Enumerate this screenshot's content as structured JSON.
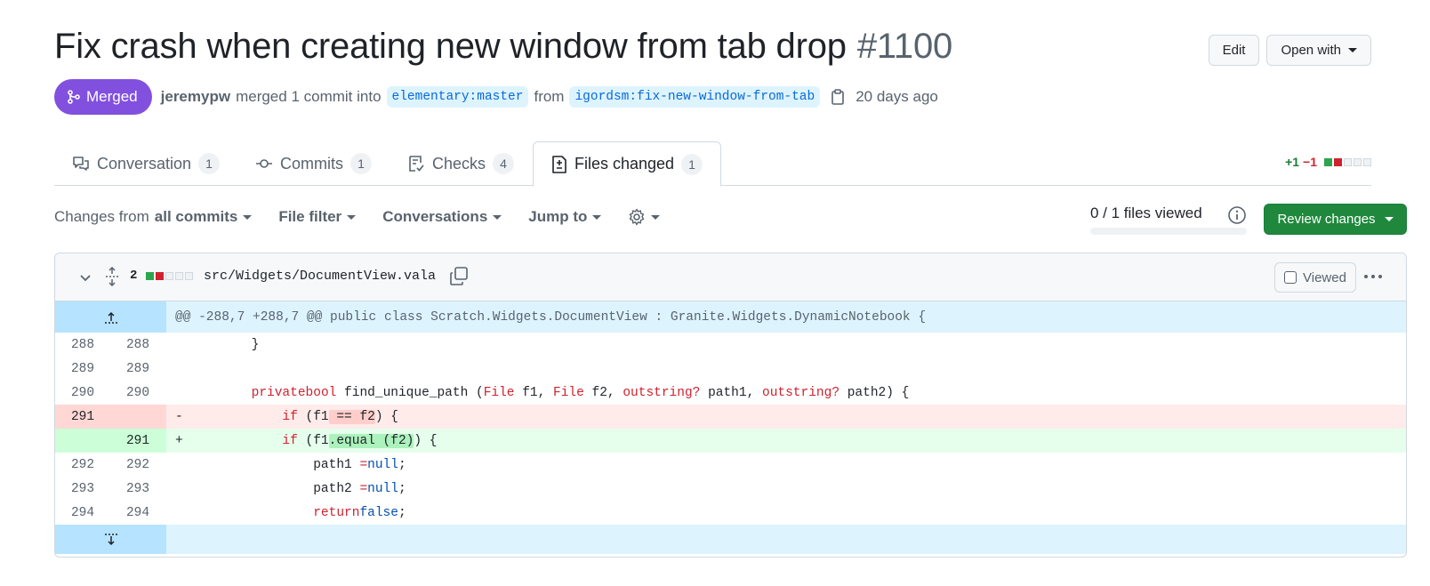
{
  "header": {
    "title": "Fix crash when creating new window from tab drop",
    "number": "#1100",
    "edit_label": "Edit",
    "open_with_label": "Open with"
  },
  "meta": {
    "status": "Merged",
    "author": "jeremypw",
    "merged_text": "merged 1 commit into",
    "base_branch": "elementary:master",
    "from_text": "from",
    "head_branch": "igordsm:fix-new-window-from-tab",
    "time": "20 days ago"
  },
  "tabs": [
    {
      "label": "Conversation",
      "count": "1",
      "icon": "comment-discussion-icon"
    },
    {
      "label": "Commits",
      "count": "1",
      "icon": "git-commit-icon"
    },
    {
      "label": "Checks",
      "count": "4",
      "icon": "checklist-icon"
    },
    {
      "label": "Files changed",
      "count": "1",
      "icon": "file-diff-icon"
    }
  ],
  "diffstat": {
    "additions": "+1",
    "deletions": "−1"
  },
  "toolbar": {
    "changes_from_prefix": "Changes from",
    "changes_from_value": "all commits",
    "file_filter": "File filter",
    "conversations": "Conversations",
    "jump_to": "Jump to"
  },
  "files_viewed": {
    "text": "0 / 1 files viewed",
    "progress": 0
  },
  "review_button": "Review changes",
  "file": {
    "changes": "2",
    "path": "src/Widgets/DocumentView.vala",
    "viewed_label": "Viewed"
  },
  "hunk_header": "@@ -288,7 +288,7 @@ public class Scratch.Widgets.DocumentView : Granite.Widgets.DynamicNotebook {",
  "lines": [
    {
      "old": "288",
      "new": "288"
    },
    {
      "old": "289",
      "new": "289"
    },
    {
      "old": "290",
      "new": "290"
    },
    {
      "old": "291",
      "new": "",
      "marker": "-"
    },
    {
      "old": "",
      "new": "291",
      "marker": "+"
    },
    {
      "old": "292",
      "new": "292"
    },
    {
      "old": "293",
      "new": "293"
    },
    {
      "old": "294",
      "new": "294"
    }
  ],
  "code": {
    "l288": "        }",
    "l290_pre": "        ",
    "l290_kw1": "private",
    "l290_ty1": "bool",
    "l290_mid1": " find_unique_path (",
    "l290_t2": "File",
    "l290_mid2": " f1, ",
    "l290_t3": "File",
    "l290_mid3": " f2, ",
    "l290_k4": "out",
    "l290_t4": "string?",
    "l290_mid4": " path1, ",
    "l290_k5": "out",
    "l290_t5": "string?",
    "l290_end": " path2) {",
    "rem_pre": "            ",
    "rem_kw": "if",
    "rem_a": " (f1",
    "rem_hl": " == f2",
    "rem_b": ") {",
    "add_pre": "            ",
    "add_kw": "if",
    "add_a": " (f1",
    "add_hl": ".equal (f2)",
    "add_b": ") {",
    "l292_pre": "                path1 ",
    "l292_eq": "=",
    "l292_null": "null",
    "l292_end": ";",
    "l293_pre": "                path2 ",
    "l293_eq": "=",
    "l293_null": "null",
    "l293_end": ";",
    "l294_pre": "                ",
    "l294_kw": "return",
    "l294_false": "false",
    "l294_end": ";"
  },
  "colors": {
    "merged": "#8250df",
    "primary": "#1f883d",
    "added_bg": "#e6ffec",
    "removed_bg": "#ffebe9",
    "hunk_bg": "#ddf4ff"
  }
}
